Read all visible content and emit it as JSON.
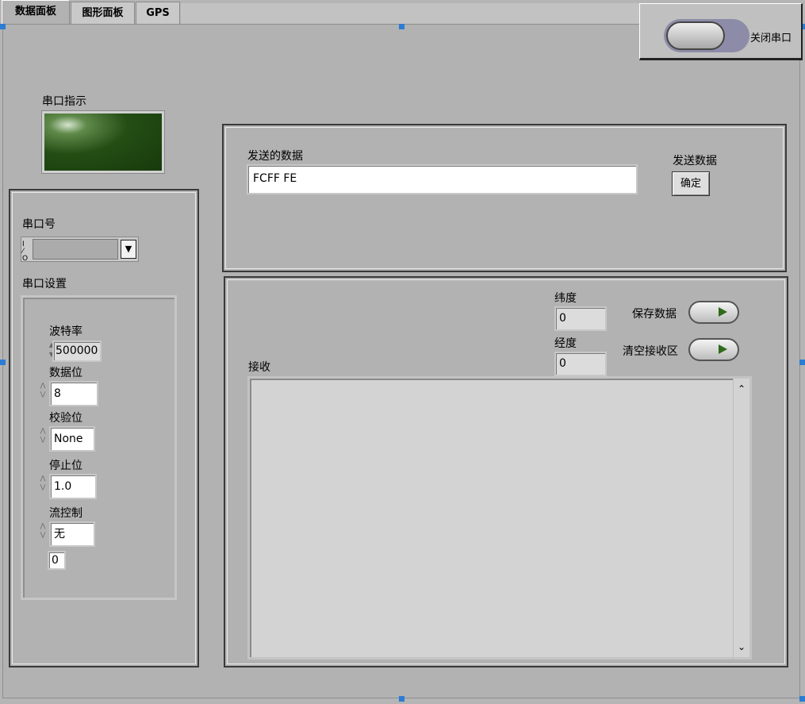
{
  "tabs": [
    {
      "label": "数据面板",
      "active": true
    },
    {
      "label": "图形面板",
      "active": false
    },
    {
      "label": "GPS",
      "active": false
    }
  ],
  "close_port": {
    "label": "关闭串口"
  },
  "port_indicator": {
    "label": "串口指示",
    "led_color": "#1e4a10"
  },
  "port": {
    "label": "串口号",
    "io_glyph": "I/O",
    "value": ""
  },
  "serial_settings": {
    "label": "串口设置",
    "baud": {
      "label": "波特率",
      "value": "500000"
    },
    "data_bits": {
      "label": "数据位",
      "value": "8"
    },
    "parity": {
      "label": "校验位",
      "value": "None"
    },
    "stop_bits": {
      "label": "停止位",
      "value": "1.0"
    },
    "flow_control": {
      "label": "流控制",
      "value": "无",
      "numeric": "0"
    }
  },
  "send": {
    "label": "发送的数据",
    "value": "FCFF FE",
    "button_caption": "发送数据",
    "button_label": "确定"
  },
  "receive": {
    "label": "接收",
    "value": "",
    "latitude": {
      "label": "纬度",
      "value": "0"
    },
    "longitude": {
      "label": "经度",
      "value": "0"
    },
    "save_data": {
      "label": "保存数据"
    },
    "clear": {
      "label": "清空接收区"
    }
  }
}
